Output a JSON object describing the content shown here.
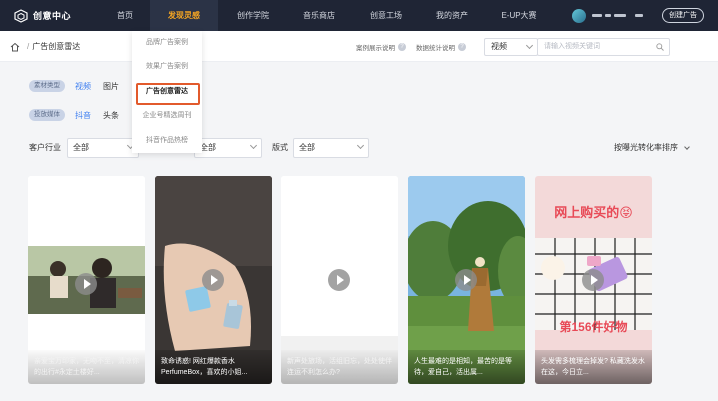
{
  "brand": {
    "name": "创意中心"
  },
  "nav": {
    "items": [
      {
        "label": "首页"
      },
      {
        "label": "发现灵感",
        "active": true
      },
      {
        "label": "创作学院"
      },
      {
        "label": "音乐商店"
      },
      {
        "label": "创意工场"
      },
      {
        "label": "我的资产"
      },
      {
        "label": "E-UP大赛"
      }
    ],
    "create_ad": "创建广告"
  },
  "breadcrumb": {
    "current": "广告创意雷达",
    "separator": "/"
  },
  "help": {
    "case_note": "案例展示说明",
    "stats_note": "数据统计说明"
  },
  "search": {
    "type": "视频",
    "placeholder": "请输入视频关键词"
  },
  "dropdown": {
    "items": [
      "品牌广告案例",
      "效果广告案例",
      "广告创意雷达",
      "企业号精选周刊",
      "抖音作品热榜"
    ],
    "highlighted_index": 2
  },
  "filters": {
    "material": {
      "tag": "素材类型",
      "options": [
        "视频",
        "图片"
      ]
    },
    "media": {
      "tag": "投放媒体",
      "options": [
        "抖音",
        "头条"
      ]
    },
    "industry": {
      "label": "客户行业",
      "value": "全部"
    },
    "second": {
      "value": "全部"
    },
    "format": {
      "label": "版式",
      "value": "全部"
    },
    "sort": "按曝光转化率排序"
  },
  "cards": [
    {
      "caption": "亲爱宝万印家，无吻不至，清凉你的出行#永定土楼好..."
    },
    {
      "caption": "致命诱惑! 网红爆款香水PerfumeBox，喜欢的小姐..."
    },
    {
      "caption": "新声处旅场，活组旧忘，处处使伴连运不利怎么办?"
    },
    {
      "caption": "人生最难的是相知，最苦的是等待，爱自己，活出属..."
    },
    {
      "caption": "头发需多梳理会掉发? 私藏洗发水在这，今日立...",
      "headline": "网上购买的😝",
      "badge": "第156件好物"
    }
  ],
  "colors": {
    "nav_bg": "#1f2535",
    "active": "#f5a623",
    "accent": "#3d7ef0",
    "highlight_border": "#e25a2c"
  }
}
